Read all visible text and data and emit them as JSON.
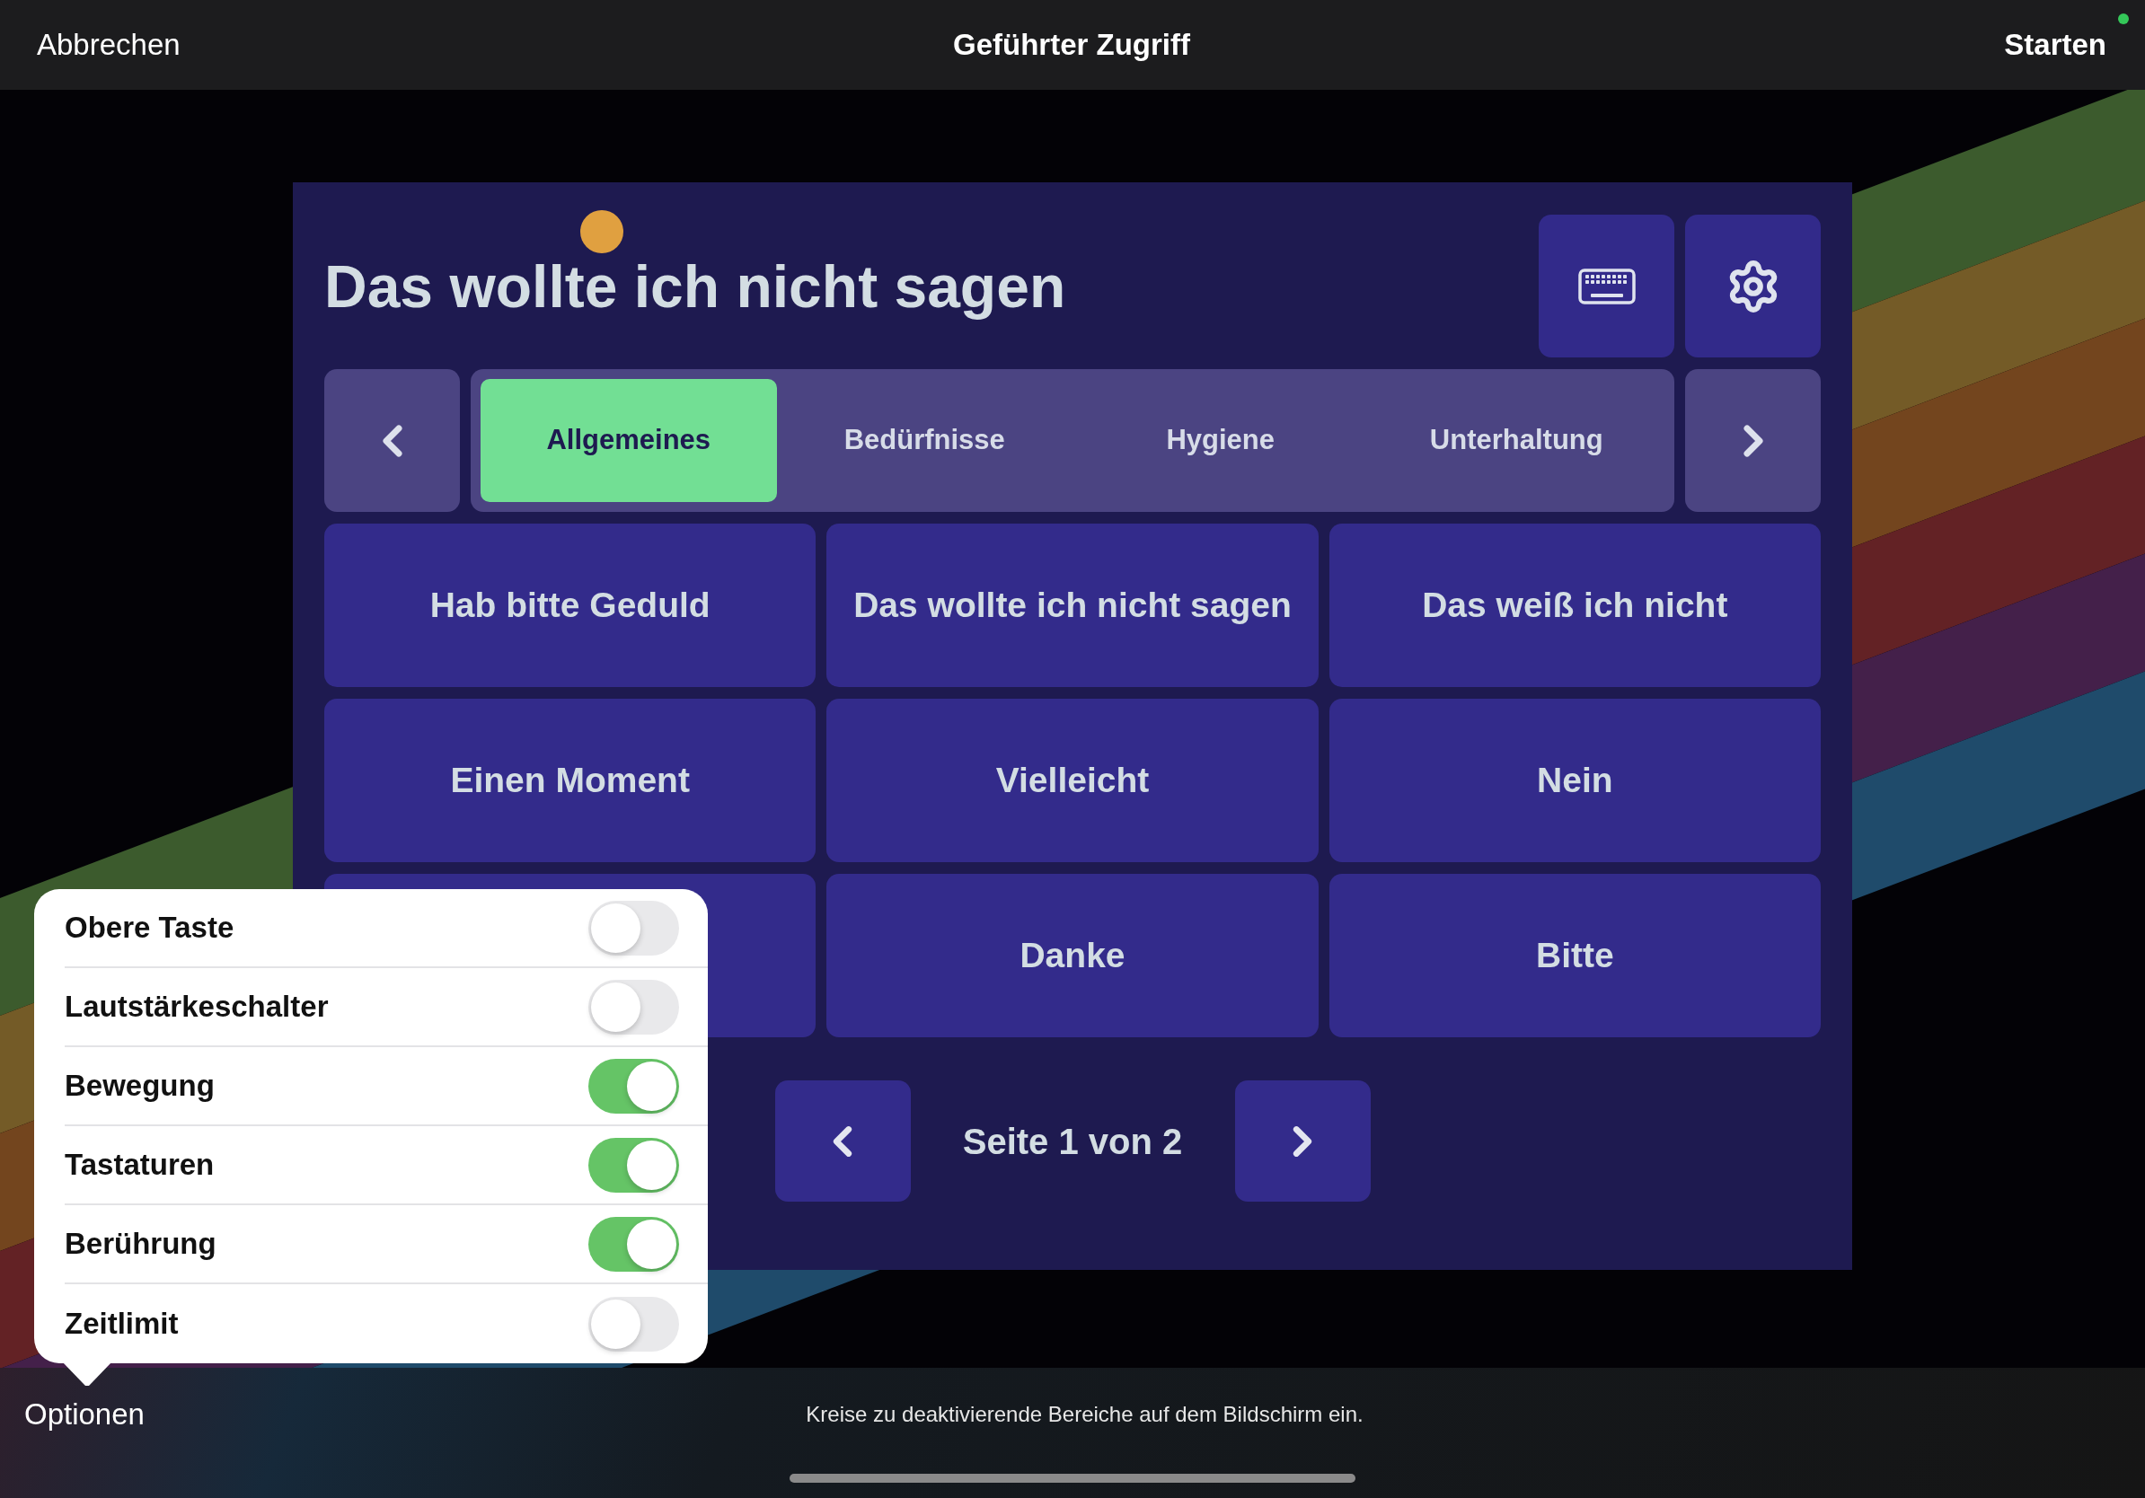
{
  "top_bar": {
    "cancel": "Abbrechen",
    "title": "Geführter Zugriff",
    "start": "Starten"
  },
  "app": {
    "title": "Das wollte ich nicht sagen",
    "category_tabs": [
      {
        "label": "Allgemeines",
        "selected": true
      },
      {
        "label": "Bedürfnisse",
        "selected": false
      },
      {
        "label": "Hygiene",
        "selected": false
      },
      {
        "label": "Unterhaltung",
        "selected": false
      }
    ],
    "phrase_tiles": [
      {
        "kind": "phrase",
        "label": "Hab bitte Geduld"
      },
      {
        "kind": "phrase",
        "label": "Das wollte ich nicht sagen"
      },
      {
        "kind": "phrase",
        "label": "Das weiß ich nicht"
      },
      {
        "kind": "phrase",
        "label": "Einen Moment"
      },
      {
        "kind": "phrase",
        "label": "Vielleicht"
      },
      {
        "kind": "phrase",
        "label": "Nein"
      },
      {
        "kind": "covered"
      },
      {
        "kind": "phrase",
        "label": "Danke"
      },
      {
        "kind": "phrase",
        "label": "Bitte"
      }
    ],
    "pagination": {
      "label": "Seite 1 von 2"
    }
  },
  "options_popover": {
    "items": [
      {
        "label": "Obere Taste",
        "on": false
      },
      {
        "label": "Lautstärkeschalter",
        "on": false
      },
      {
        "label": "Bewegung",
        "on": true
      },
      {
        "label": "Tastaturen",
        "on": true
      },
      {
        "label": "Berührung",
        "on": true
      },
      {
        "label": "Zeitlimit",
        "on": false
      }
    ]
  },
  "bottom_bar": {
    "options": "Optionen",
    "hint": "Kreise zu deaktivierende Bereiche auf dem Bildschirm ein."
  }
}
